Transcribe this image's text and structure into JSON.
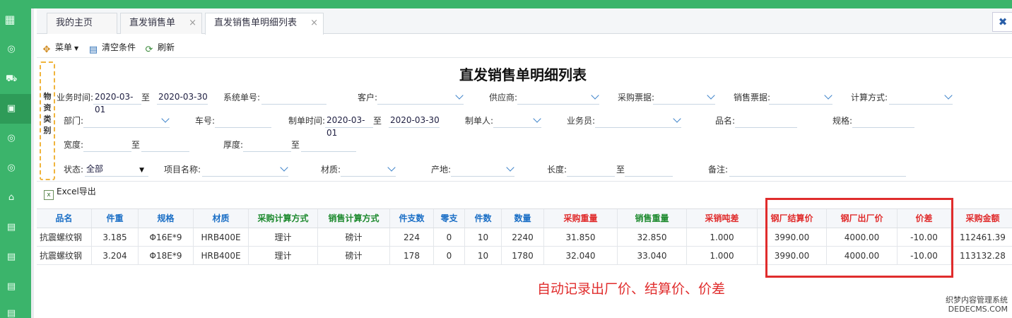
{
  "tabs": [
    {
      "label": "我的主页",
      "closable": false
    },
    {
      "label": "直发销售单",
      "closable": true
    },
    {
      "label": "直发销售单明细列表",
      "closable": true,
      "active": true
    }
  ],
  "tab_close_glyph": "×",
  "close_all_glyph": "✖",
  "toolbar": {
    "menu_label": "菜单",
    "clear_label": "清空条件",
    "refresh_label": "刷新"
  },
  "category_label": "物资类别",
  "page_title": "直发销售单明细列表",
  "filters": {
    "biz_time_label": "业务时间:",
    "biz_time_from": "2020-03-01",
    "to_label": "至",
    "biz_time_to": "2020-03-30",
    "sys_no_label": "系统单号:",
    "customer_label": "客户:",
    "supplier_label": "供应商:",
    "purchase_bill_label": "采购票据:",
    "sales_bill_label": "销售票据:",
    "calc_method_label": "计算方式:",
    "dept_label": "部门:",
    "car_no_label": "车号:",
    "make_time_label": "制单时间:",
    "make_time_from": "2020-03-01",
    "make_time_to": "2020-03-30",
    "maker_label": "制单人:",
    "salesman_label": "业务员:",
    "product_label": "品名:",
    "spec_label": "规格:",
    "width_label": "宽度:",
    "thickness_label": "厚度:",
    "status_label": "状态:",
    "status_value": "全部",
    "project_label": "项目名称:",
    "material_label": "材质:",
    "origin_label": "产地:",
    "length_label": "长度:",
    "remark_label": "备注:"
  },
  "excel_label": "Excel导出",
  "table": {
    "headers": [
      "品名",
      "件重",
      "规格",
      "材质",
      "采购计算方式",
      "销售计算方式",
      "件支数",
      "零支",
      "件数",
      "数量",
      "采购重量",
      "销售重量",
      "采销吨差",
      "钢厂结算价",
      "钢厂出厂价",
      "价差",
      "采购金额"
    ],
    "header_colors": [
      "#1b6fc6",
      "#1b6fc6",
      "#1b6fc6",
      "#1b6fc6",
      "#1d8a2e",
      "#1d8a2e",
      "#1b6fc6",
      "#1b6fc6",
      "#1b6fc6",
      "#1b6fc6",
      "#e02c2c",
      "#1d8a2e",
      "#e02c2c",
      "#e02c2c",
      "#e02c2c",
      "#e02c2c",
      "#e02c2c"
    ],
    "rows": [
      [
        "抗震螺纹钢",
        "3.185",
        "Φ16E*9",
        "HRB400E",
        "理计",
        "磅计",
        "224",
        "0",
        "10",
        "2240",
        "31.850",
        "32.850",
        "1.000",
        "3990.00",
        "4000.00",
        "-10.00",
        "112461.39"
      ],
      [
        "抗震螺纹钢",
        "3.204",
        "Φ18E*9",
        "HRB400E",
        "理计",
        "磅计",
        "178",
        "0",
        "10",
        "1780",
        "32.040",
        "33.040",
        "1.000",
        "3990.00",
        "4000.00",
        "-10.00",
        "113132.28"
      ]
    ]
  },
  "annotation": "自动记录出厂价、结算价、价差",
  "watermark": [
    "织梦内容管理系统",
    "DEDECMS.COM"
  ]
}
